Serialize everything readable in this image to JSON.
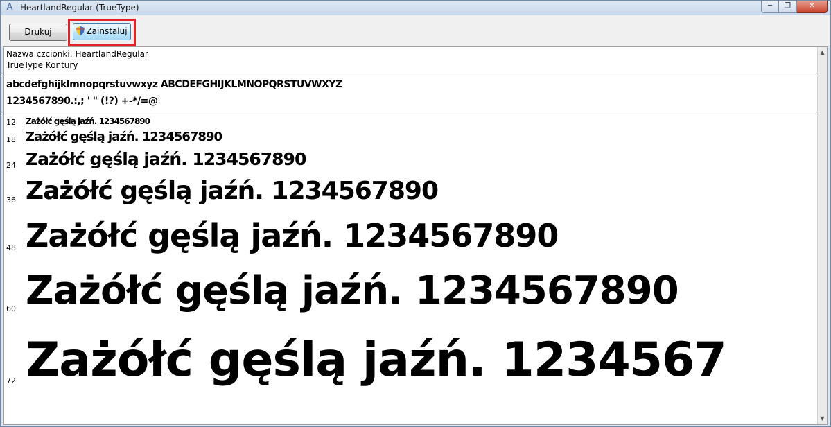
{
  "window": {
    "title": "HeartlandRegular (TrueType)"
  },
  "toolbar": {
    "print_label": "Drukuj",
    "install_label": "Zainstaluj"
  },
  "font_info": {
    "name_line": "Nazwa czcionki: HeartlandRegular",
    "type_line": "TrueType Kontury"
  },
  "charset": {
    "line1": "abcdefghijklmnopqrstuvwxyz ABCDEFGHIJKLMNOPQRSTUVWXYZ",
    "line2": "1234567890.:,; ' \" (!?) +-*/=@"
  },
  "samples": [
    {
      "size": "12",
      "text": "Zażółć gęślą jaźń. 1234567890"
    },
    {
      "size": "18",
      "text": "Zażółć gęślą jaźń. 1234567890"
    },
    {
      "size": "24",
      "text": "Zażółć gęślą jaźń. 1234567890"
    },
    {
      "size": "36",
      "text": "Zażółć gęślą jaźń. 1234567890"
    },
    {
      "size": "48",
      "text": "Zażółć gęślą jaźń. 1234567890"
    },
    {
      "size": "60",
      "text": "Zażółć gęślą jaźń. 1234567890"
    },
    {
      "size": "72",
      "text": "Zażółć gęślą jaźń. 1234567"
    }
  ]
}
